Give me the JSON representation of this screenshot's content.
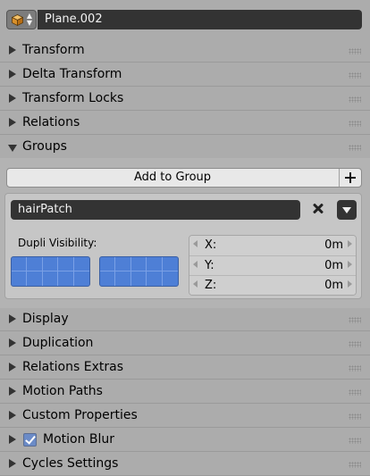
{
  "header": {
    "object_icon": "cube-icon",
    "object_name": "Plane.002"
  },
  "panels_top": [
    {
      "label": "Transform",
      "expanded": false
    },
    {
      "label": "Delta Transform",
      "expanded": false
    },
    {
      "label": "Transform Locks",
      "expanded": false
    },
    {
      "label": "Relations",
      "expanded": false
    },
    {
      "label": "Groups",
      "expanded": true
    }
  ],
  "groups": {
    "add_button_label": "Add to Group",
    "group_name": "hairPatch",
    "dupli_visibility_label": "Dupli Visibility:",
    "offset": [
      {
        "axis": "X:",
        "value": "0m"
      },
      {
        "axis": "Y:",
        "value": "0m"
      },
      {
        "axis": "Z:",
        "value": "0m"
      }
    ]
  },
  "panels_bottom": [
    {
      "label": "Display",
      "expanded": false
    },
    {
      "label": "Duplication",
      "expanded": false
    },
    {
      "label": "Relations Extras",
      "expanded": false
    },
    {
      "label": "Motion Paths",
      "expanded": false
    },
    {
      "label": "Custom Properties",
      "expanded": false
    },
    {
      "label": "Motion Blur",
      "expanded": false,
      "checkbox": true
    },
    {
      "label": "Cycles Settings",
      "expanded": false
    }
  ],
  "colors": {
    "background": "#acacac",
    "field_dark": "#333333",
    "layer_blue": "#4e7fd6"
  }
}
